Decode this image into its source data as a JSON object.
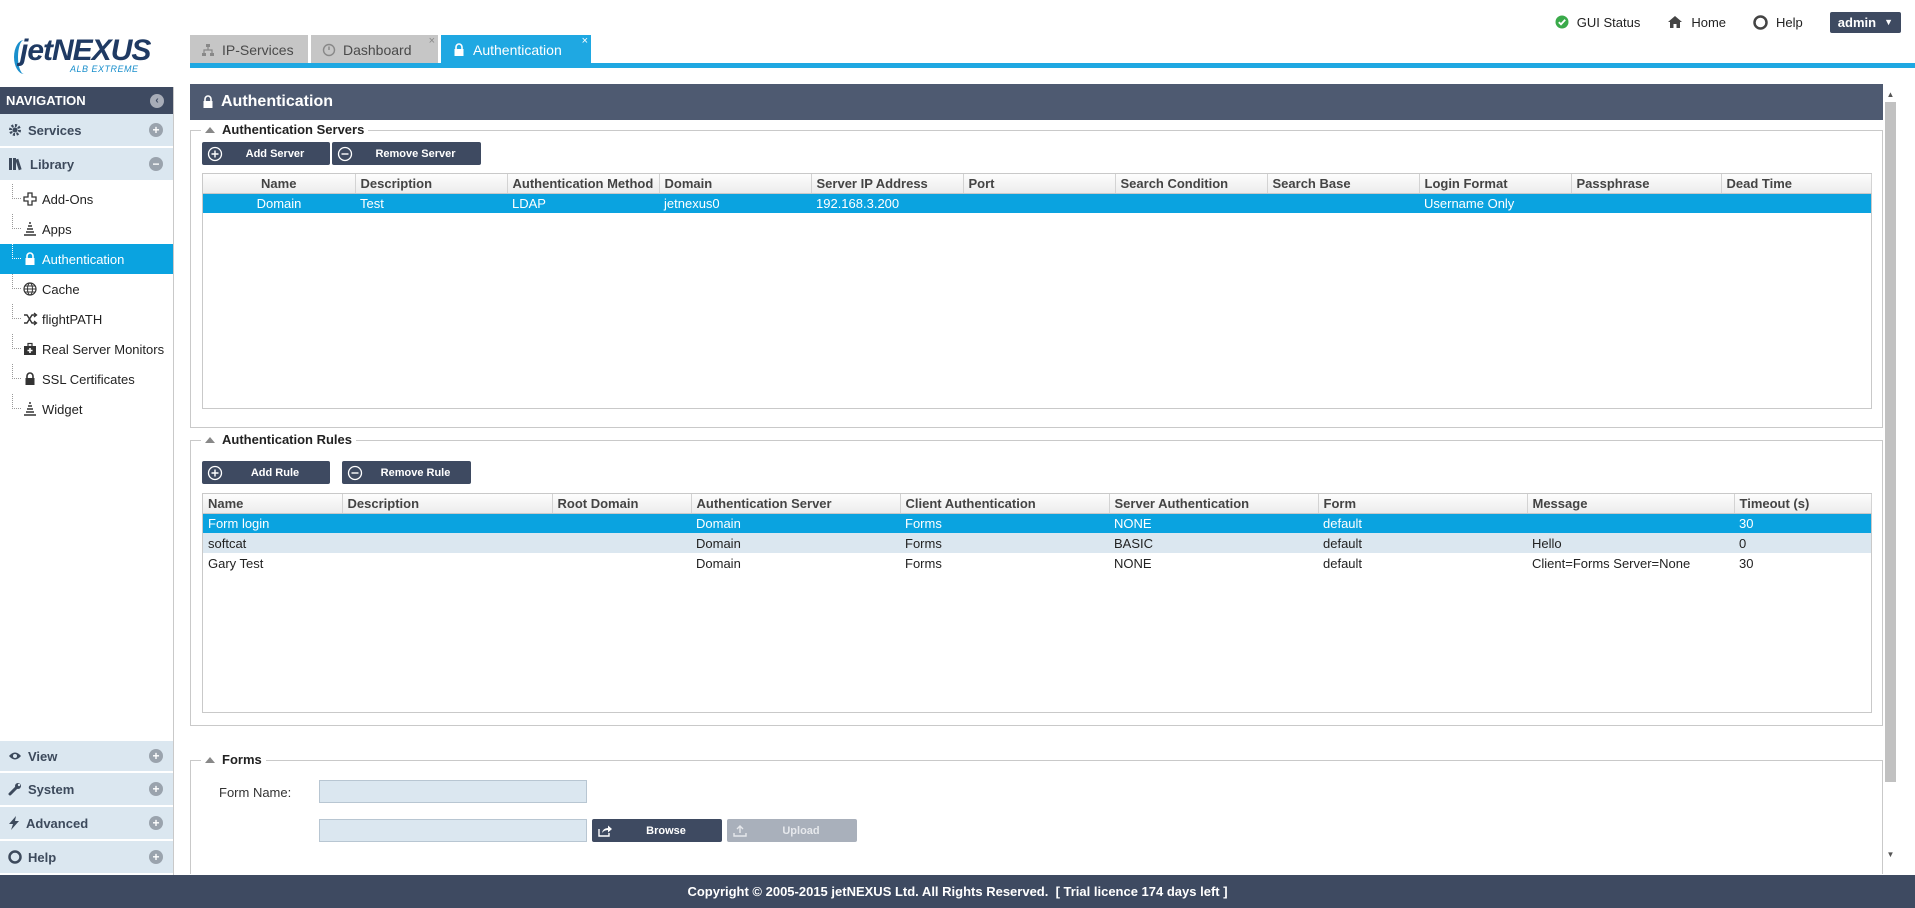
{
  "brand": {
    "logo_main": "jetNEXUS",
    "logo_sub": "ALB EXTREME"
  },
  "tabs": [
    {
      "label": "IP-Services",
      "icon": "network-icon"
    },
    {
      "label": "Dashboard",
      "icon": "gauge-icon",
      "close": "×"
    },
    {
      "label": "Authentication",
      "icon": "lock-icon",
      "close": "×"
    }
  ],
  "topbar": {
    "gui_status": "GUI Status",
    "home": "Home",
    "help": "Help",
    "user": "admin",
    "user_caret": "▼"
  },
  "nav": {
    "title": "NAVIGATION",
    "collapse": "‹",
    "sections": {
      "services": {
        "label": "Services",
        "toggle": "+"
      },
      "library": {
        "label": "Library",
        "toggle": "−"
      },
      "view": {
        "label": "View",
        "toggle": "+"
      },
      "system": {
        "label": "System",
        "toggle": "+"
      },
      "advanced": {
        "label": "Advanced",
        "toggle": "+"
      },
      "help": {
        "label": "Help",
        "toggle": "+"
      }
    },
    "library_items": [
      {
        "label": "Add-Ons",
        "icon": "puzzle-icon"
      },
      {
        "label": "Apps",
        "icon": "apps-icon"
      },
      {
        "label": "Authentication",
        "icon": "lock-icon",
        "active": true
      },
      {
        "label": "Cache",
        "icon": "globe-icon"
      },
      {
        "label": "flightPATH",
        "icon": "shuffle-icon"
      },
      {
        "label": "Real Server Monitors",
        "icon": "medkit-icon"
      },
      {
        "label": "SSL Certificates",
        "icon": "lock-icon"
      },
      {
        "label": "Widget",
        "icon": "apps-icon"
      }
    ]
  },
  "panel": {
    "title": "Authentication"
  },
  "servers": {
    "legend": "Authentication Servers",
    "add_button": "Add Server",
    "remove_button": "Remove Server",
    "columns": [
      "Name",
      "Description",
      "Authentication Method",
      "Domain",
      "Server IP Address",
      "Port",
      "Search Condition",
      "Search Base",
      "Login Format",
      "Passphrase",
      "Dead Time"
    ],
    "rows": [
      [
        "Domain",
        "Test",
        "LDAP",
        "jetnexus0",
        "192.168.3.200",
        "",
        "",
        "",
        "Username Only",
        "",
        ""
      ]
    ]
  },
  "rules": {
    "legend": "Authentication Rules",
    "add_button": "Add Rule",
    "remove_button": "Remove Rule",
    "columns": [
      "Name",
      "Description",
      "Root Domain",
      "Authentication Server",
      "Client Authentication",
      "Server Authentication",
      "Form",
      "Message",
      "Timeout (s)"
    ],
    "rows": [
      [
        "Form login",
        "",
        "",
        "Domain",
        "Forms",
        "NONE",
        "default",
        "",
        "30"
      ],
      [
        "softcat",
        "",
        "",
        "Domain",
        "Forms",
        "BASIC",
        "default",
        "Hello",
        "0"
      ],
      [
        "Gary Test",
        "",
        "",
        "Domain",
        "Forms",
        "NONE",
        "default",
        "Client=Forms Server=None",
        "30"
      ]
    ]
  },
  "forms": {
    "legend": "Forms",
    "form_name_label": "Form Name:",
    "form_name_value": "",
    "file_value": "",
    "browse_button": "Browse",
    "upload_button": "Upload"
  },
  "footer": {
    "text": "Copyright © 2005-2015 jetNEXUS Ltd. All Rights Reserved.  [ Trial licence 174 days left ]"
  },
  "colors": {
    "accent": "#1fa8e2",
    "selected_row": "#0aa3e0",
    "dark_header": "#3e4a61",
    "panel_title": "#4e5a71",
    "alt_row": "#dbe7f0"
  }
}
